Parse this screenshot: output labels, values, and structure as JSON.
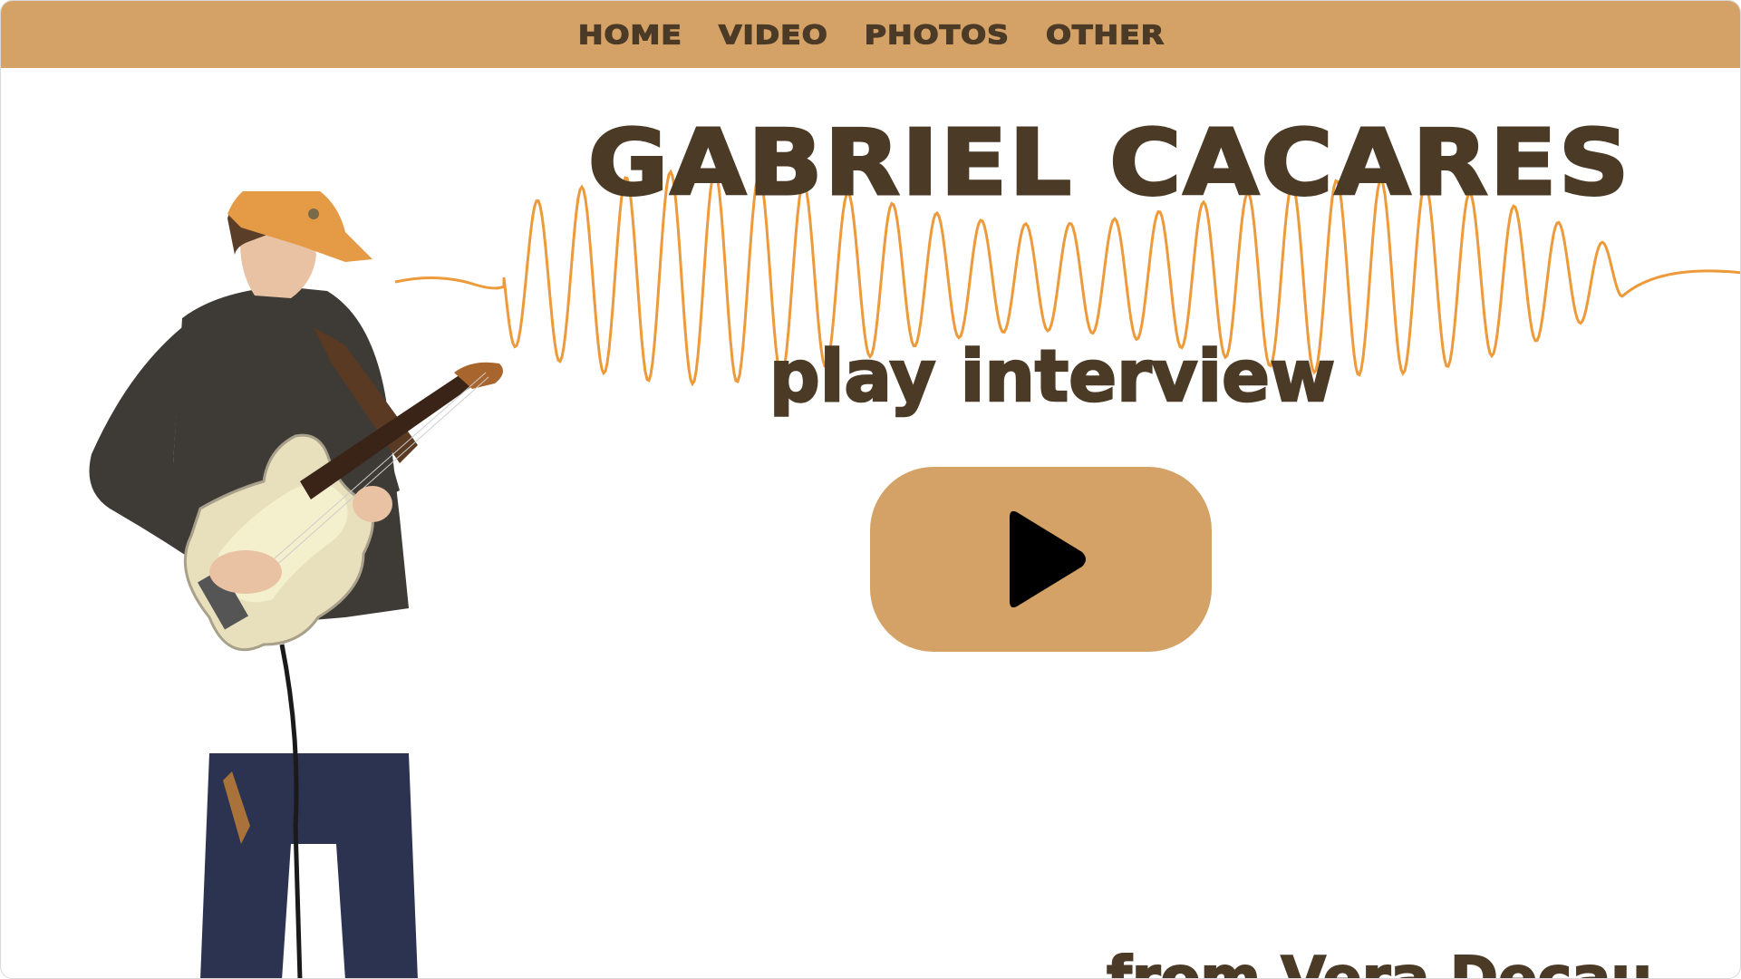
{
  "nav": {
    "items": [
      {
        "label": "HOME"
      },
      {
        "label": "VIDEO"
      },
      {
        "label": "PHOTOS"
      },
      {
        "label": "OTHER"
      }
    ]
  },
  "hero": {
    "title": "GABRIEL CACARES",
    "subtitle": "play interview",
    "play_icon": "play-icon"
  },
  "footer": {
    "credit": "from Vera Decau"
  },
  "colors": {
    "accent": "#d4a266",
    "text": "#4a3a26",
    "wave": "#ec9a3a",
    "background": "#ffffff"
  }
}
